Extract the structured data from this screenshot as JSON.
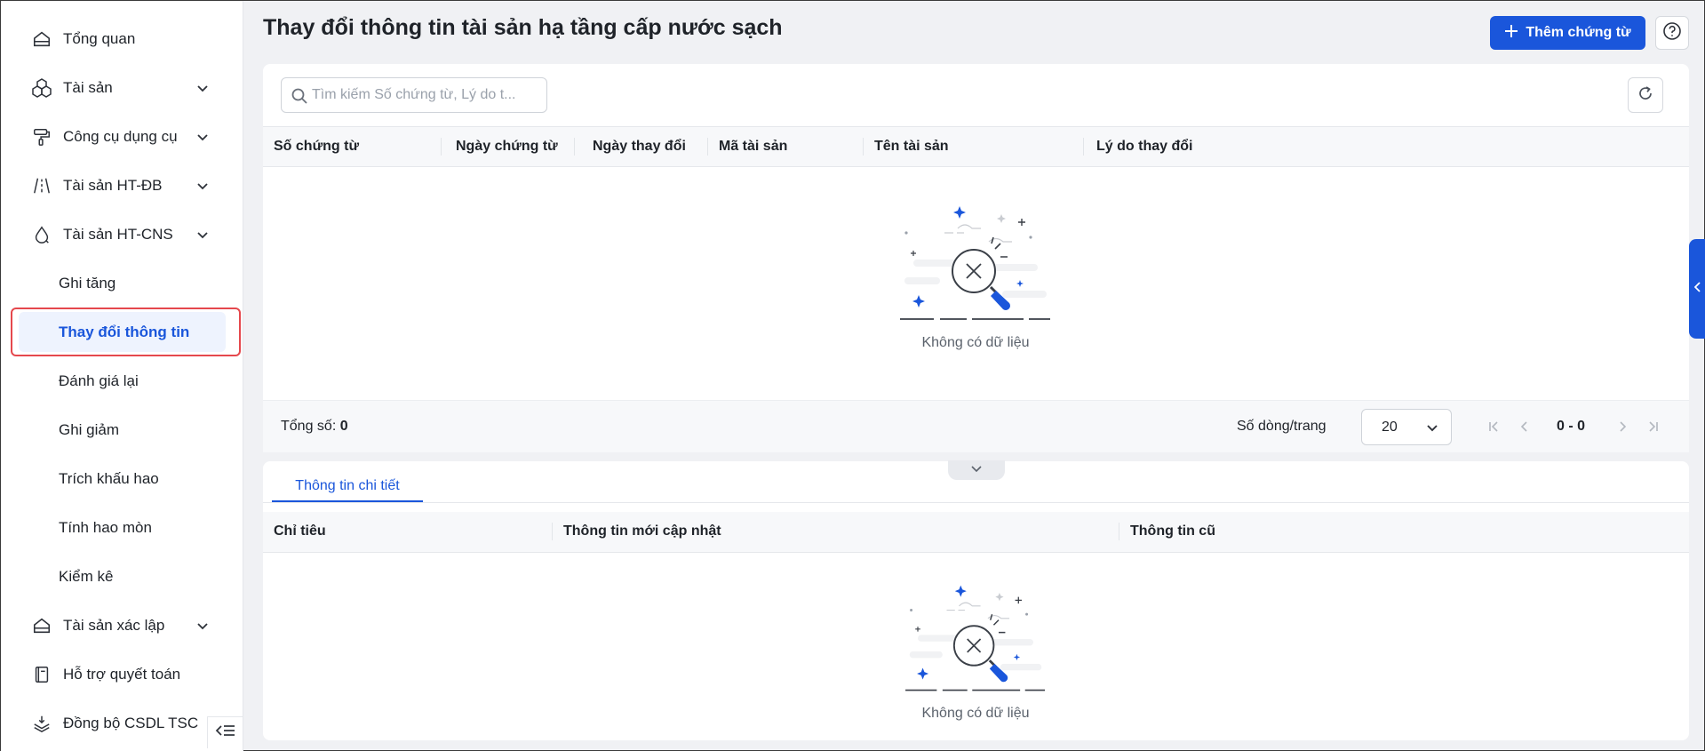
{
  "sidebar": {
    "items": [
      {
        "label": "Tổng quan",
        "icon": "home-icon"
      },
      {
        "label": "Tài sản",
        "icon": "cubes-icon"
      },
      {
        "label": "Công cụ dụng cụ",
        "icon": "paint-roller-icon"
      },
      {
        "label": "Tài sản HT-ĐB",
        "icon": "road-icon"
      },
      {
        "label": "Tài sản HT-CNS",
        "icon": "water-drop-icon"
      },
      {
        "label": "Tài sản xác lập",
        "icon": "home-icon"
      },
      {
        "label": "Hỗ trợ quyết toán",
        "icon": "ledger-icon"
      },
      {
        "label": "Đồng bộ CSDL TSC",
        "icon": "layers-sync-icon"
      }
    ],
    "sub_items": [
      {
        "label": "Ghi tăng"
      },
      {
        "label": "Thay đổi thông tin",
        "active": true
      },
      {
        "label": "Đánh giá lại"
      },
      {
        "label": "Ghi giảm"
      },
      {
        "label": "Trích khấu hao"
      },
      {
        "label": "Tính hao mòn"
      },
      {
        "label": "Kiểm kê"
      }
    ]
  },
  "header": {
    "title": "Thay đổi thông tin tài sản hạ tầng cấp nước sạch",
    "add_button": "Thêm chứng từ"
  },
  "search": {
    "placeholder": "Tìm kiếm Số chứng từ, Lý do t..."
  },
  "table": {
    "columns": [
      "Số chứng từ",
      "Ngày chứng từ",
      "Ngày thay đổi",
      "Mã tài sản",
      "Tên tài sản",
      "Lý do thay đổi"
    ],
    "rows": [],
    "empty_text": "Không có dữ liệu"
  },
  "footer": {
    "total_label": "Tổng số:",
    "total_value": "0",
    "rows_per_page_label": "Số dòng/trang",
    "rows_per_page": "20",
    "range": "0 - 0"
  },
  "detail": {
    "tab_label": "Thông tin chi tiết",
    "columns": [
      "Chỉ tiêu",
      "Thông tin mới cập nhật",
      "Thông tin cũ"
    ],
    "rows": [],
    "empty_text": "Không có dữ liệu"
  },
  "colors": {
    "primary": "#1a56db",
    "active_bg": "#eef3fe",
    "highlight": "#e5484d"
  }
}
